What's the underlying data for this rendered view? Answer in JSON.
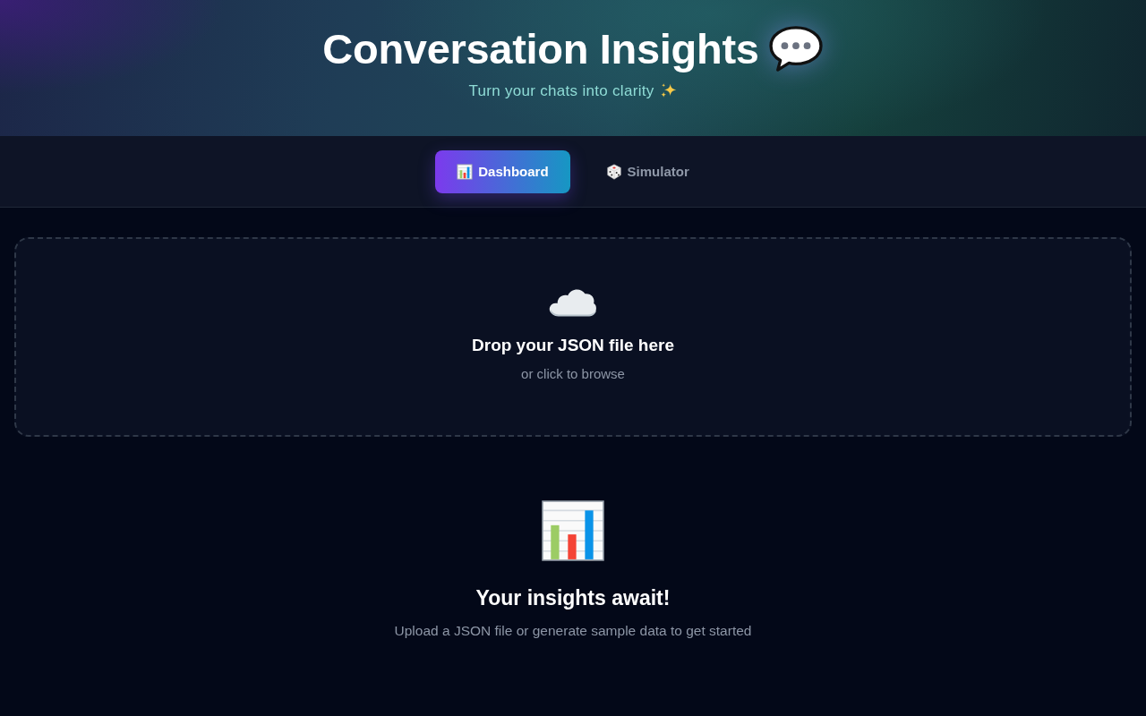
{
  "header": {
    "title": "Conversation Insights",
    "subtitle": "Turn your chats into clarity"
  },
  "tabs": [
    {
      "label": "Dashboard",
      "selected": true,
      "kind": "chart"
    },
    {
      "label": "Simulator",
      "selected": false,
      "kind": "dice"
    }
  ],
  "dropzone": {
    "title": "Drop your JSON file here",
    "hint": "or click to browse"
  },
  "empty_state": {
    "title": "Your insights await!",
    "message": "Upload a JSON file or generate sample data to get started"
  }
}
